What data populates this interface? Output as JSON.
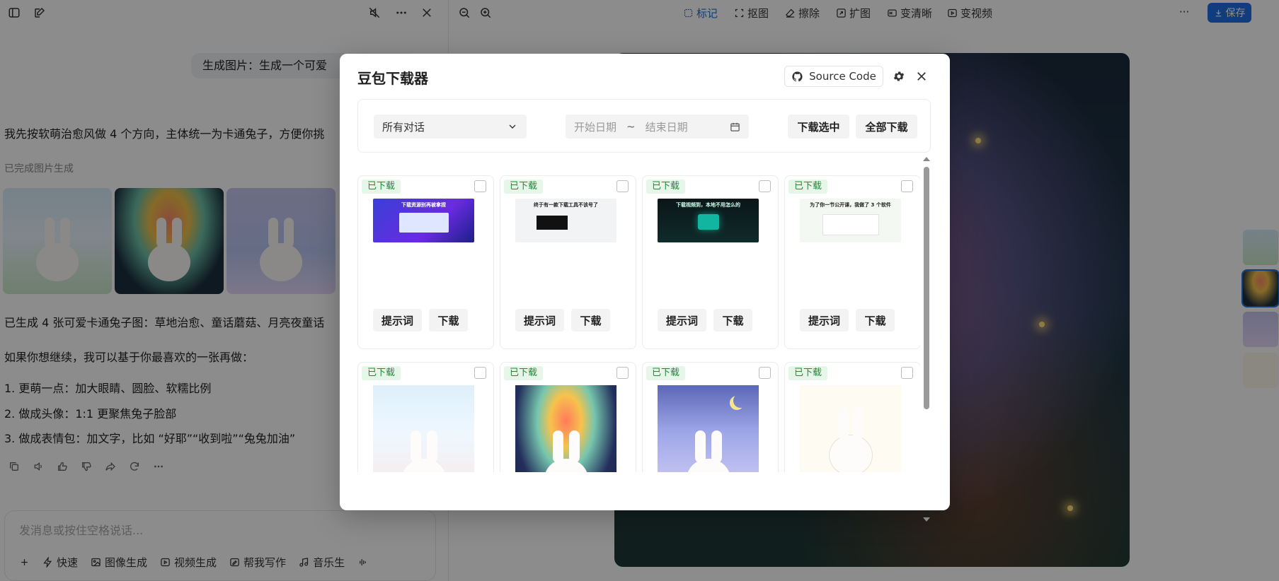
{
  "chat": {
    "user_message": "生成图片：生成一个可爱",
    "reply_intro": "我先按软萌治愈风做 4 个方向，主体统一为卡通兔子，方便你挑",
    "image_status": "已完成图片生成",
    "summary": "已生成 4 张可爱卡通兔子图：草地治愈、童话蘑菇、月亮夜童话",
    "followup": "如果你想继续，我可以基于你最喜欢的一张再做：",
    "options": [
      "1. 更萌一点：加大眼睛、圆脸、软糯比例",
      "2. 做成头像：1:1 更聚焦兔子脸部",
      "3. 做成表情包：加文字，比如 “好耶”“收到啦”“兔兔加油”"
    ],
    "composer_placeholder": "发消息或按住空格说话...",
    "tools": {
      "fast": "快速",
      "image": "图像生成",
      "video": "视频生成",
      "write": "帮我写作",
      "music": "音乐生"
    }
  },
  "editor": {
    "toolbar": {
      "mark": "标记",
      "cutout": "抠图",
      "erase": "擦除",
      "expand": "扩图",
      "sharpen": "变清晰",
      "to_video": "变视频",
      "more": "···",
      "save": "保存"
    }
  },
  "modal": {
    "title": "豆包下载器",
    "source_code": "Source Code",
    "conversation_select": "所有对话",
    "start_date_placeholder": "开始日期",
    "date_separator": "~",
    "end_date_placeholder": "结束日期",
    "download_selected": "下载选中",
    "download_all": "全部下载",
    "card_badge": "已下载",
    "prompt_btn": "提示词",
    "download_btn": "下载",
    "top_cards": [
      {
        "headline": "下载资源别再被拿捏"
      },
      {
        "headline": "终于有一款下载工具不该号了"
      },
      {
        "headline": "下载视频到，本地不用怎么的"
      },
      {
        "headline": "为了你一节公开课，我做了 3 个软件"
      }
    ]
  },
  "colors": {
    "accent": "#1f6fe5",
    "badge_bg": "#e6f6e9",
    "badge_text": "#1d8a3a"
  }
}
